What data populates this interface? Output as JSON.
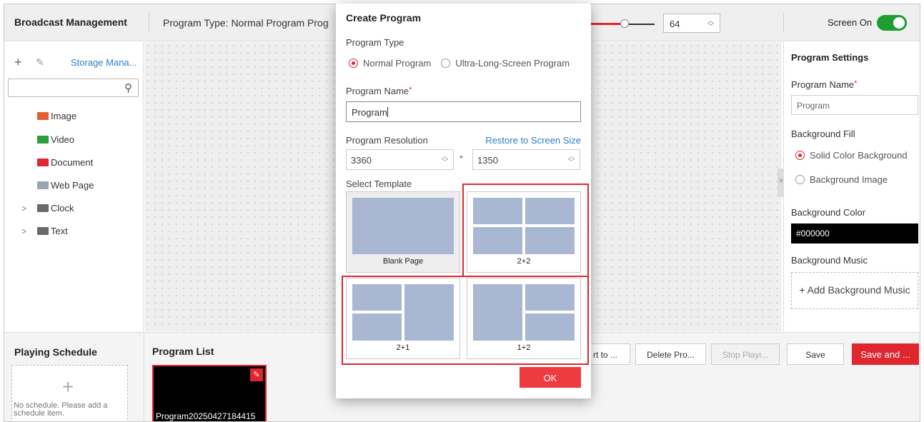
{
  "header": {
    "title": "Broadcast Management",
    "program_type": "Program Type: Normal Program  Prog",
    "volume": "64",
    "volume_level": 0.55,
    "screen_label": "Screen On",
    "screen_on": true
  },
  "sidebar": {
    "storage_link": "Storage Mana...",
    "search_placeholder": "",
    "items": [
      {
        "label": "Image",
        "icon": "image-icon",
        "color": "#e0602e",
        "expandable": false
      },
      {
        "label": "Video",
        "icon": "video-icon",
        "color": "#2f9d3c",
        "expandable": false
      },
      {
        "label": "Document",
        "icon": "document-icon",
        "color": "#e0262e",
        "expandable": false
      },
      {
        "label": "Web Page",
        "icon": "web-page-icon",
        "color": "#9aa6b2",
        "expandable": false
      },
      {
        "label": "Clock",
        "icon": "clock-icon",
        "color": "#6a6a6a",
        "expandable": true
      },
      {
        "label": "Text",
        "icon": "text-icon",
        "color": "#6a6a6a",
        "expandable": true
      }
    ]
  },
  "settings": {
    "title": "Program Settings",
    "name_label": "Program Name",
    "name_value": "Program",
    "fill_label": "Background Fill",
    "fill_solid": "Solid Color Background",
    "fill_image": "Background Image",
    "color_label": "Background Color",
    "color_value": "#000000",
    "music_label": "Background Music",
    "music_button": "+ Add Background Music"
  },
  "bottom": {
    "schedule_title": "Playing Schedule",
    "schedule_empty": "No schedule. Please add a schedule item.",
    "program_list_title": "Program List",
    "program_name": "Program20250427184415",
    "buttons": [
      {
        "label": "rt to ...",
        "disabled": false
      },
      {
        "label": "Delete Pro...",
        "disabled": false
      },
      {
        "label": "Stop Playi...",
        "disabled": true
      }
    ],
    "save_label": "Save",
    "save_and_label": "Save and ..."
  },
  "modal": {
    "title": "Create Program",
    "type_label": "Program Type",
    "type_normal": "Normal Program",
    "type_ultra": "Ultra-Long-Screen Program",
    "name_label": "Program Name",
    "name_value": "Program",
    "resolution_label": "Program Resolution",
    "restore_link": "Restore to Screen Size",
    "width": "3360",
    "height": "1350",
    "separator": "*",
    "template_label": "Select Template",
    "templates": [
      {
        "label": "Blank Page"
      },
      {
        "label": "2+2"
      },
      {
        "label": "2+1"
      },
      {
        "label": "1+2"
      }
    ],
    "ok_label": "OK"
  },
  "colors": {
    "accent_red": "#e0262e",
    "link_blue": "#2a7ec9",
    "toggle_green": "#1f9d2f",
    "template_cell": "#a9b7d2"
  }
}
